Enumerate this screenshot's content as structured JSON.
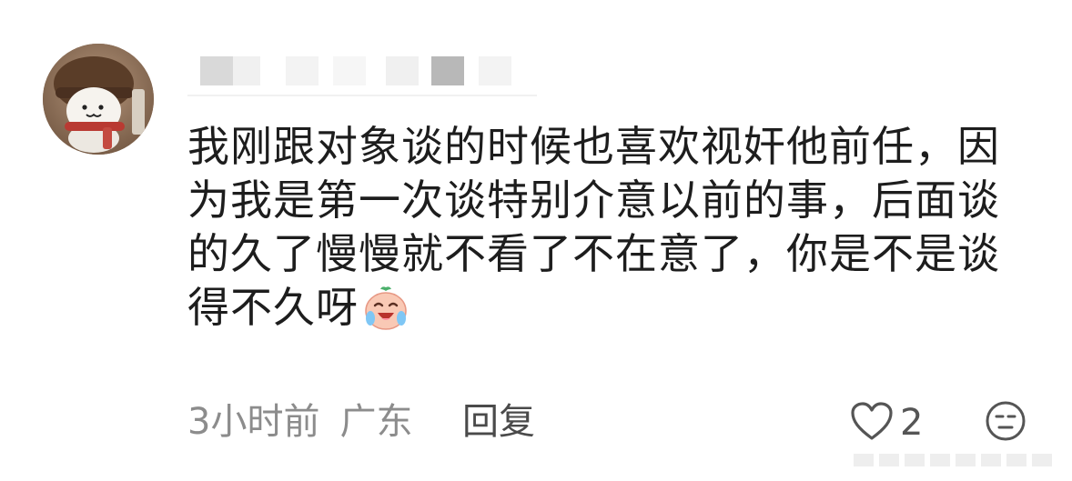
{
  "comment": {
    "lines": [
      "我刚跟对象谈的时候也喜欢视奸他前任，因",
      "为我是第一次谈特别介意以前的事，后面谈",
      "的久了慢慢就不看了不在意了，你是不是谈",
      "得不久呀"
    ],
    "trailing_emoji": "crying-laughing-peach-emoji"
  },
  "meta": {
    "time": "3小时前",
    "location": "广东",
    "reply_label": "回复"
  },
  "actions": {
    "like_count": "2",
    "like_icon": "heart-outline-icon",
    "dislike_icon": "unamused-face-icon"
  },
  "colors": {
    "text": "#1d1d1d",
    "meta": "#8c8c8c",
    "reply": "#4a4a4a",
    "icon": "#555555"
  }
}
